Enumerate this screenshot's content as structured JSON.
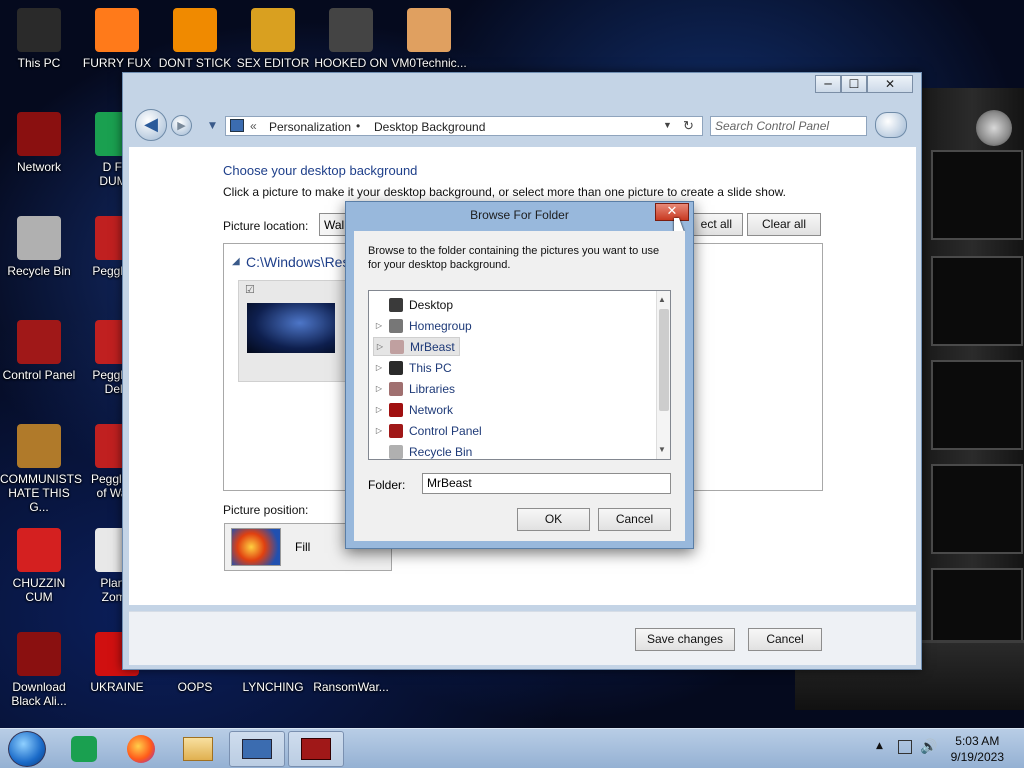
{
  "desktop": {
    "icons": [
      {
        "label": "This PC",
        "icon": "monitor-icon",
        "color": "#2a2a2a"
      },
      {
        "label": "FURRY FUX",
        "icon": "firefox-icon",
        "color": "#ff7a1a"
      },
      {
        "label": "DONT STICK",
        "icon": "vlc-cone-icon",
        "color": "#f08a00"
      },
      {
        "label": "SEX EDITOR",
        "icon": "hxd-icon",
        "color": "#d9a020"
      },
      {
        "label": "HOOKED ON",
        "icon": "app-icon",
        "color": "#444444"
      },
      {
        "label": "VM0Technic...",
        "icon": "doctor-icon",
        "color": "#e0a060"
      },
      {
        "label": "Network",
        "icon": "network-alien-icon",
        "color": "#8a1010"
      },
      {
        "label": "D FO\nDUMB",
        "icon": "spreadsheet-icon",
        "color": "#1aa050"
      },
      {
        "label": "Recycle Bin",
        "icon": "recycle-bin-icon",
        "color": "#b0b0b0"
      },
      {
        "label": "Peggle D",
        "icon": "peggle-icon",
        "color": "#c02020"
      },
      {
        "label": "Control Panel",
        "icon": "control-panel-icon",
        "color": "#a01818"
      },
      {
        "label": "Peggle N\nDelu",
        "icon": "peggle-icon",
        "color": "#c02020"
      },
      {
        "label": "COMMUNISTS\nHATE THIS G...",
        "icon": "money-bag-icon",
        "color": "#b07a2a"
      },
      {
        "label": "Peggle W\nof Warc",
        "icon": "peggle-icon",
        "color": "#c02020"
      },
      {
        "label": "CHUZZIN\nCUM",
        "icon": "chuzzle-icon",
        "color": "#d42020"
      },
      {
        "label": "Plants\nZomb",
        "icon": "flower-icon",
        "color": "#e8e8e8"
      },
      {
        "label": "Download\nBlack Ali...",
        "icon": "alien-download-icon",
        "color": "#8a1010"
      },
      {
        "label": "UKRAINE",
        "icon": "radiation-icon",
        "color": "#d01010"
      },
      {
        "label": "OOPS",
        "icon": "blank-icon",
        "color": "#000000"
      },
      {
        "label": "LYNCHING",
        "icon": "blank-icon",
        "color": "#000000"
      },
      {
        "label": "RansomWar...",
        "icon": "blank-icon",
        "color": "#000000"
      }
    ]
  },
  "control_panel": {
    "address": {
      "chevrons": "«",
      "crumb1": "Personalization",
      "separator": "•",
      "crumb2": "Desktop Background"
    },
    "search_placeholder": "Search Control Panel",
    "heading": "Choose your desktop background",
    "instructions": "Click a picture to make it your desktop background, or select more than one picture to create a slide show.",
    "picture_location_label": "Picture location:",
    "picture_location_value": "Wall",
    "select_all_label": "ect all",
    "clear_all_label": "Clear all",
    "folder_group": "C:\\Windows\\Res",
    "picture_position_label": "Picture position:",
    "picture_position_value": "Fill",
    "save_label": "Save changes",
    "cancel_label": "Cancel",
    "window_buttons": {
      "minimize": "─",
      "maximize": "☐",
      "close": "✕"
    }
  },
  "browse_dialog": {
    "title": "Browse For Folder",
    "description": "Browse to the folder containing the pictures you want to use for your desktop background.",
    "tree": [
      {
        "label": "Desktop",
        "icon": "desktop-icon",
        "color": "#3a3a3a",
        "has_children": false
      },
      {
        "label": "Homegroup",
        "icon": "homegroup-icon",
        "color": "#777777",
        "has_children": true
      },
      {
        "label": "MrBeast",
        "icon": "user-folder-icon",
        "color": "#c0a0a0",
        "has_children": true,
        "selected": true
      },
      {
        "label": "This PC",
        "icon": "monitor-icon",
        "color": "#2a2a2a",
        "has_children": true
      },
      {
        "label": "Libraries",
        "icon": "libraries-icon",
        "color": "#a07070",
        "has_children": true
      },
      {
        "label": "Network",
        "icon": "network-icon",
        "color": "#a01010",
        "has_children": true
      },
      {
        "label": "Control Panel",
        "icon": "control-panel-icon",
        "color": "#a01818",
        "has_children": true
      },
      {
        "label": "Recycle Bin",
        "icon": "recycle-bin-icon",
        "color": "#b0b0b0",
        "has_children": false
      }
    ],
    "folder_label": "Folder:",
    "folder_value": "MrBeast",
    "ok_label": "OK",
    "cancel_label": "Cancel",
    "close_label": "✕"
  },
  "taskbar": {
    "apps": [
      {
        "icon": "start-orb-icon"
      },
      {
        "icon": "spreadsheet-icon"
      },
      {
        "icon": "firefox-icon"
      },
      {
        "icon": "file-explorer-icon"
      },
      {
        "icon": "control-panel-window-icon"
      },
      {
        "icon": "control-panel-icon"
      }
    ],
    "time": "5:03 AM",
    "date": "9/19/2023"
  }
}
